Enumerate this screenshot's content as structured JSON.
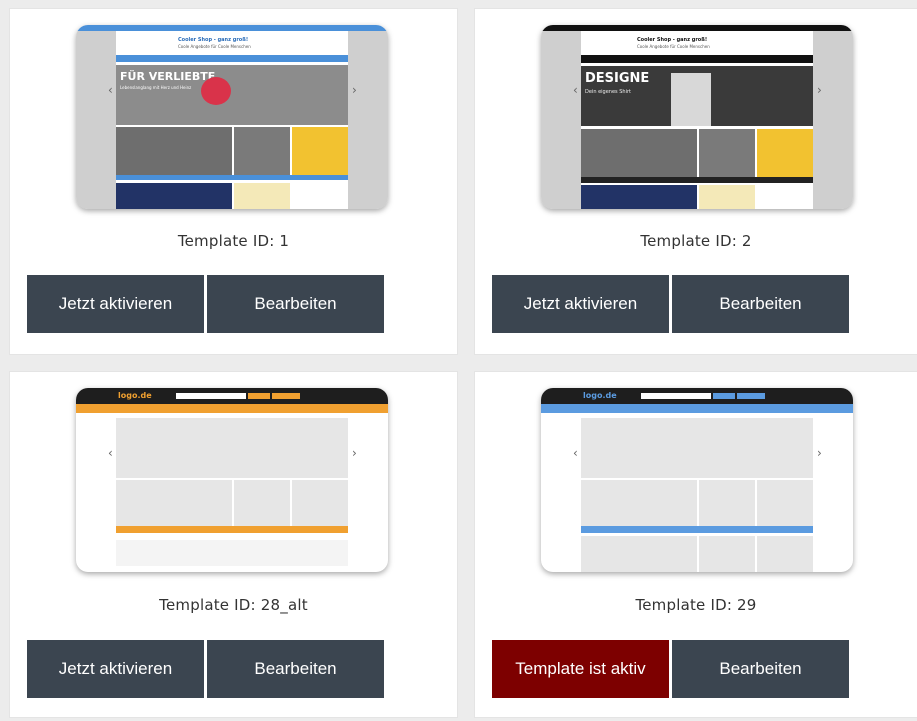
{
  "cards": [
    {
      "caption": "Template ID: 1",
      "buttons": {
        "primary": "Jetzt aktivieren",
        "secondary": "Bearbeiten"
      },
      "active": false,
      "preview": {
        "shop_title": "Cooler Shop - ganz groß!",
        "shop_sub": "Coole Angebote für Coole Menschen",
        "banner_text": "FÜR VERLIEBTE",
        "banner_sub": "Lebenslanglang mit Herz und Heinz",
        "theme_color": "#4a90d9"
      }
    },
    {
      "caption": "Template ID: 2",
      "buttons": {
        "primary": "Jetzt aktivieren",
        "secondary": "Bearbeiten"
      },
      "active": false,
      "preview": {
        "shop_title": "Cooler Shop - ganz groß!",
        "shop_sub": "Coole Angebote für Coole Menschen",
        "banner_text": "DESIGNE",
        "banner_sub": "Dein eigenes Shirt",
        "theme_color": "#111111"
      }
    },
    {
      "caption": "Template ID: 28_alt",
      "buttons": {
        "primary": "Jetzt aktivieren",
        "secondary": "Bearbeiten"
      },
      "active": false,
      "preview": {
        "logo": "logo.de",
        "theme_color": "#f0a030"
      }
    },
    {
      "caption": "Template ID: 29",
      "buttons": {
        "primary": "Template ist aktiv",
        "secondary": "Bearbeiten"
      },
      "active": true,
      "preview": {
        "logo": "logo.de",
        "theme_color": "#5b9be0"
      }
    }
  ],
  "colors": {
    "button": "#3b4550",
    "active_button": "#7d0000"
  }
}
